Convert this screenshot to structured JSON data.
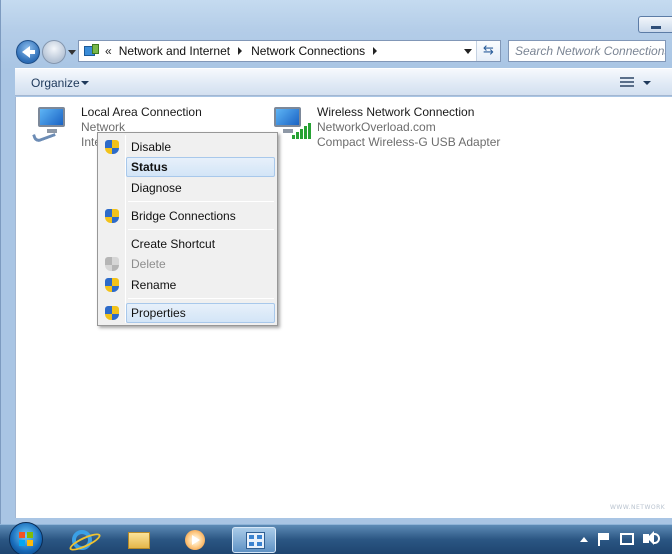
{
  "window": {
    "breadcrumb": {
      "overflow": "«",
      "items": [
        "Network and Internet",
        "Network Connections"
      ]
    },
    "search": {
      "placeholder": "Search Network Connections"
    },
    "toolbar": {
      "organize_label": "Organize"
    }
  },
  "connections": [
    {
      "name": "Local Area Connection",
      "line1": "Network",
      "line2": "Inte",
      "icon": "wired-network-adapter-icon"
    },
    {
      "name": "Wireless Network Connection",
      "line1": "NetworkOverload.com",
      "line2": "Compact Wireless-G USB Adapter",
      "icon": "wireless-network-adapter-icon"
    }
  ],
  "context_menu": {
    "items": [
      {
        "label": "Disable",
        "shield": true
      },
      {
        "label": "Status",
        "bold": true,
        "highlighted": true
      },
      {
        "label": "Diagnose"
      },
      {
        "label": "Bridge Connections",
        "shield": true
      },
      {
        "label": "Create Shortcut"
      },
      {
        "label": "Delete",
        "shield": true,
        "disabled": true
      },
      {
        "label": "Rename",
        "shield": true
      },
      {
        "label": "Properties",
        "shield": true,
        "highlighted": true
      }
    ]
  },
  "taskbar": {
    "apps": [
      "internet-explorer-icon",
      "windows-explorer-icon",
      "windows-media-player-icon",
      "network-sharing-center-icon"
    ]
  },
  "colors": {
    "accent": "#2d6db6",
    "menu_highlight": "#d3e5f7",
    "shield_blue": "#2d6bc9",
    "shield_yellow": "#f2c21a"
  }
}
